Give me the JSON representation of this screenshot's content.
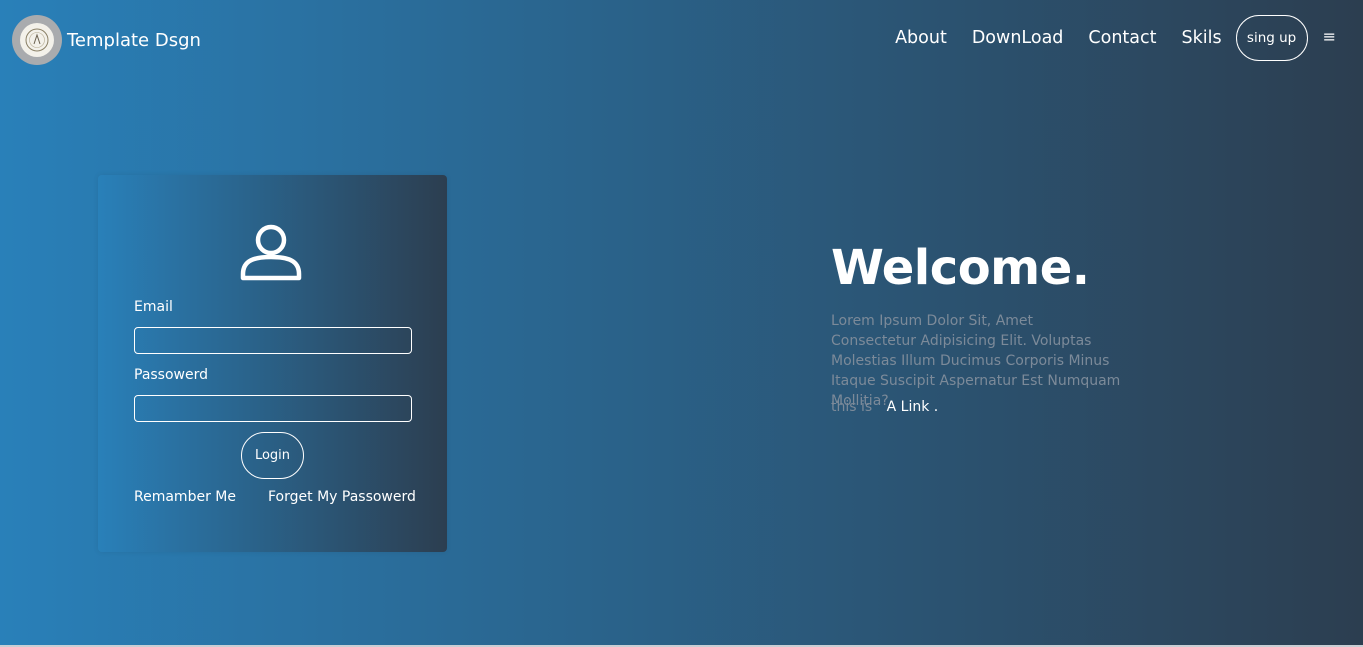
{
  "header": {
    "logo_icon": "circular-seal-logo",
    "brand_name": "Template Dsgn",
    "nav": {
      "about": "About",
      "download": "DownLoad",
      "contact": "Contact",
      "skills": "Skils"
    },
    "signup_label": "sing up",
    "menu_glyph": "≡",
    "menu_icon": "hamburger-menu-icon"
  },
  "login": {
    "user_icon": "user-icon",
    "email_label": "Email",
    "email_value": "",
    "password_label": "Passowerd",
    "password_value": "",
    "login_label": "Login",
    "remember_label": "Remamber Me",
    "forget_label": "Forget My Passowerd"
  },
  "welcome": {
    "title": "Welcome.",
    "body": "Lorem Ipsum Dolor Sit, Amet Consectetur Adipisicing Elit. Voluptas Molestias Illum Ducimus Corporis Minus Itaque Suscipit Aspernatur Est Numquam Mollitia?",
    "link_prefix": "this is",
    "link_text": "A Link ."
  },
  "colors": {
    "gradient_start": "#2980b9",
    "gradient_end": "#2c3e50",
    "muted_text": "#7c8a99"
  }
}
